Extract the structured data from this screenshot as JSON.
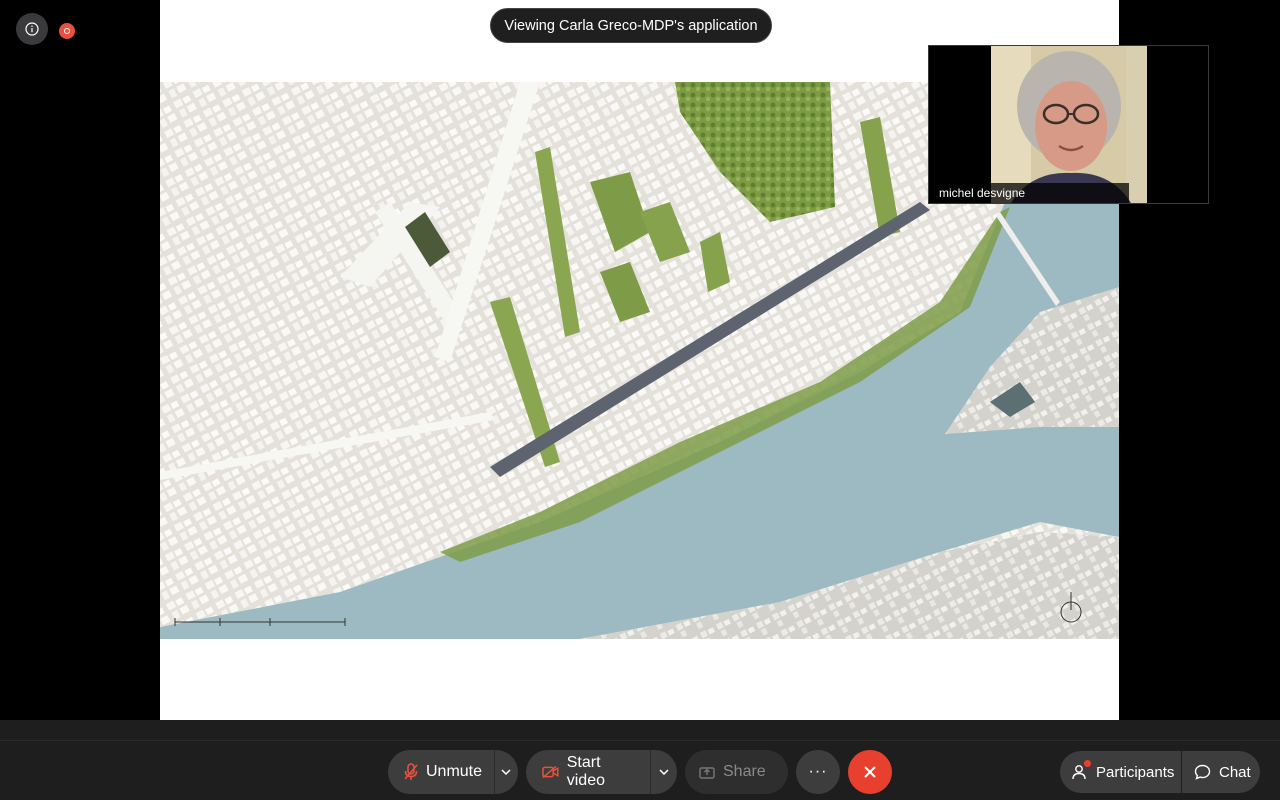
{
  "banner": {
    "text": "Viewing Carla Greco-MDP's application"
  },
  "video": {
    "participant_name": "michel desvigne"
  },
  "toolbar": {
    "unmute_label": "Unmute",
    "start_video_label": "Start video",
    "share_label": "Share",
    "more_label": "···",
    "participants_label": "Participants",
    "chat_label": "Chat"
  },
  "colors": {
    "end_call": "#e8402f",
    "recording": "#e8513d",
    "mic_muted": "#e8513d",
    "notification_dot": "#e8402f"
  },
  "icons": [
    "info-icon",
    "recording-icon",
    "mic-off-icon",
    "video-off-icon",
    "share-icon",
    "more-icon",
    "close-icon",
    "participants-icon",
    "chat-icon",
    "chevron-down-icon"
  ]
}
